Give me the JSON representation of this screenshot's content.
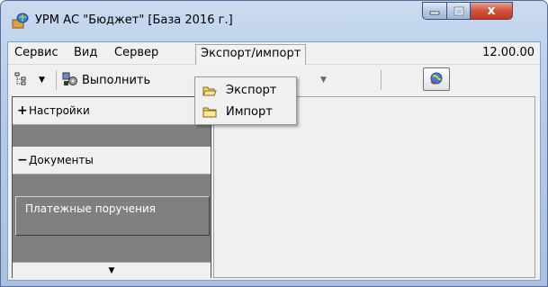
{
  "window": {
    "title": "УРМ АС \"Бюджет\" [База 2016 г.]",
    "close_glyph": "x",
    "app_icon": "urm-app-icon"
  },
  "menubar": {
    "items": [
      {
        "label": "Сервис"
      },
      {
        "label": "Вид"
      },
      {
        "label": "Сервер"
      },
      {
        "label": "Экспорт/импорт",
        "active": true
      }
    ],
    "version": "12.00.00"
  },
  "toolbar": {
    "tree_icon": "tree-icon",
    "run_icon": "run-icon",
    "run_label": "Выполнить",
    "active_icon": "globe-refresh-icon",
    "dropdown_arrow": "▼"
  },
  "export_menu": {
    "items": [
      {
        "label": "Экспорт",
        "icon": "folder-open-icon"
      },
      {
        "label": "Импорт",
        "icon": "folder-icon"
      }
    ]
  },
  "left_panel": {
    "sections": [
      {
        "sign": "+",
        "label": "Настройки"
      },
      {
        "sign": "−",
        "label": "Документы"
      }
    ],
    "documents": [
      {
        "label": "Платежные поручения"
      }
    ],
    "scroll_arrow": "▼"
  },
  "colors": {
    "panel_grey": "#808080",
    "close_red": "#c23a22",
    "title_blue": "#b5cbe8"
  }
}
